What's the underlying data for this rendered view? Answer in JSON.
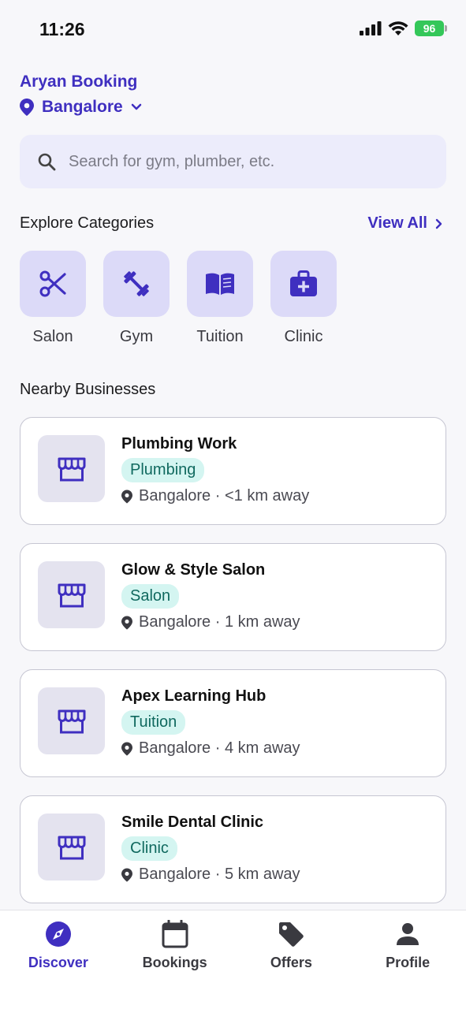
{
  "status_bar": {
    "time": "11:26",
    "battery": "96"
  },
  "header": {
    "app_title": "Aryan Booking",
    "location": "Bangalore"
  },
  "search": {
    "placeholder": "Search for gym, plumber, etc."
  },
  "categories_section": {
    "title": "Explore Categories",
    "view_all": "View All",
    "items": [
      {
        "label": "Salon",
        "icon": "scissors-icon"
      },
      {
        "label": "Gym",
        "icon": "dumbbell-icon"
      },
      {
        "label": "Tuition",
        "icon": "book-icon"
      },
      {
        "label": "Clinic",
        "icon": "medical-kit-icon"
      }
    ]
  },
  "nearby_section": {
    "title": "Nearby Businesses",
    "businesses": [
      {
        "name": "Plumbing Work",
        "category": "Plumbing",
        "location": "Bangalore · <1 km away"
      },
      {
        "name": "Glow & Style Salon",
        "category": "Salon",
        "location": "Bangalore · 1 km away"
      },
      {
        "name": "Apex Learning Hub",
        "category": "Tuition",
        "location": "Bangalore · 4 km away"
      },
      {
        "name": "Smile Dental Clinic",
        "category": "Clinic",
        "location": "Bangalore · 5 km away"
      }
    ]
  },
  "tabbar": {
    "active": "Discover",
    "tabs": [
      {
        "label": "Discover",
        "icon": "compass-icon"
      },
      {
        "label": "Bookings",
        "icon": "calendar-icon"
      },
      {
        "label": "Offers",
        "icon": "tag-icon"
      },
      {
        "label": "Profile",
        "icon": "person-icon"
      }
    ]
  },
  "colors": {
    "accent": "#3f2fc0",
    "tile_bg": "#dcdaf8",
    "tag_bg": "#d4f5f1",
    "tag_text": "#10695f",
    "battery": "#34c759"
  }
}
